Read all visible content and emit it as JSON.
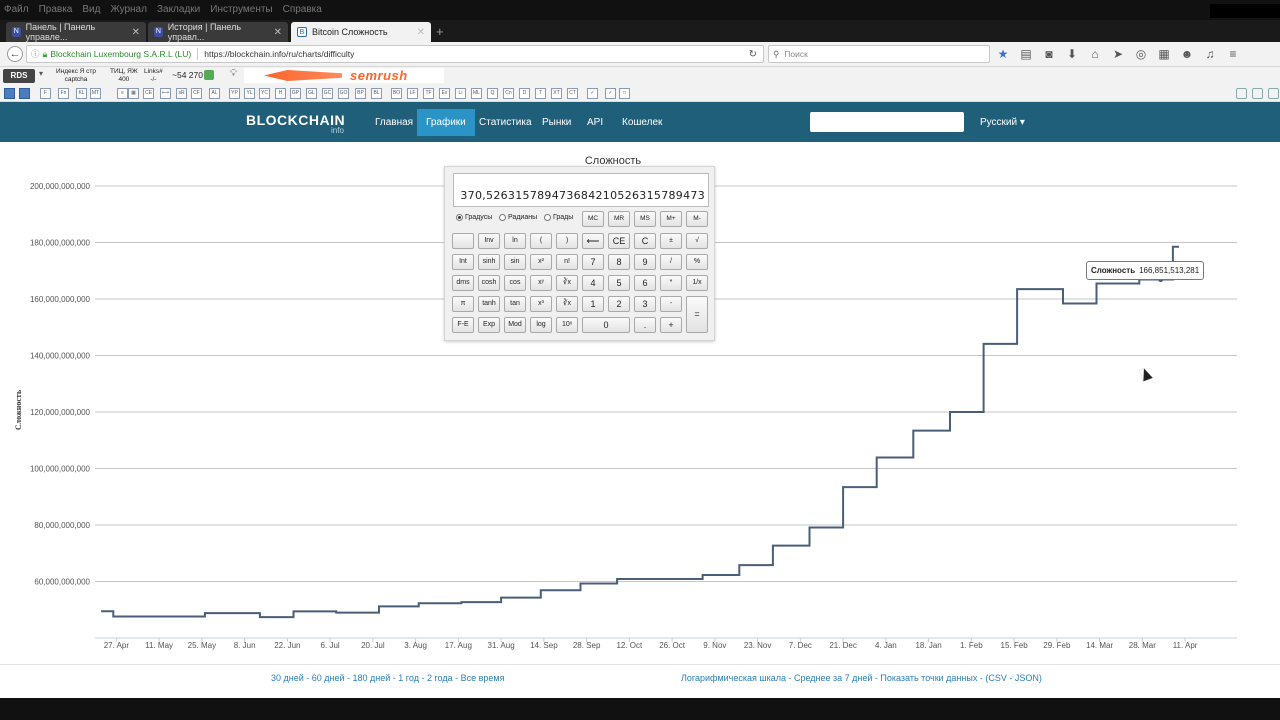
{
  "browser": {
    "menu": [
      "Файл",
      "Правка",
      "Вид",
      "Журнал",
      "Закладки",
      "Инструменты",
      "Справка"
    ],
    "tabs": [
      {
        "label": "Панель | Панель управле...",
        "icon": "N"
      },
      {
        "label": "История | Панель управл...",
        "icon": "N"
      },
      {
        "label": "Bitcoin Сложность",
        "icon": "B"
      }
    ],
    "url_org": "Blockchain Luxembourg S.A.R.L (LU)",
    "url": "https://blockchain.info/ru/charts/difficulty",
    "search_placeholder": "Поиск",
    "icons": [
      "bookmark-star-icon",
      "reading-list-icon",
      "pocket-icon",
      "download-icon",
      "home-icon",
      "send-icon",
      "addon-icon",
      "sidebar-icon",
      "chat-icon",
      "music-icon",
      "menu-icon"
    ]
  },
  "extensions": {
    "rds_label": "RDS",
    "stats": [
      {
        "top": "Индекс Я стр",
        "bottom": "captcha"
      },
      {
        "top": "ТИЦ, ЯЖ",
        "bottom": "400"
      },
      {
        "top": "Links#",
        "bottom": "-/-"
      }
    ],
    "links_count": "~54 270",
    "semrush_label": "semrush",
    "mini_icons": [
      "F",
      "Fn",
      "KL",
      "MT",
      "≡",
      "▦",
      "CE",
      "⟷",
      "sR",
      "CF",
      "AL",
      "YP",
      "YL",
      "YC",
      "H",
      "GP",
      "GL",
      "GC",
      "GO",
      "BP",
      "BL",
      "BO",
      "LF",
      "TF",
      "Ex",
      "Li",
      "ML",
      "Q",
      "Cn",
      "D",
      "T",
      "XT",
      "CT",
      "✓",
      "✓",
      "□"
    ]
  },
  "site": {
    "logo": "BLOCKCHAIN",
    "logo_sub": "info",
    "nav": [
      "Главная",
      "Графики",
      "Статистика",
      "Рынки",
      "API",
      "Кошелек"
    ],
    "active_nav": "Графики",
    "language": "Русский ▾"
  },
  "chart_data": {
    "type": "line",
    "title": "Сложность",
    "ylabel": "Сложность",
    "xlabel": "",
    "ylim": [
      40000000000,
      200000000000
    ],
    "yticks": [
      "60,000,000,000",
      "80,000,000,000",
      "100,000,000,000",
      "120,000,000,000",
      "140,000,000,000",
      "160,000,000,000",
      "180,000,000,000",
      "200,000,000,000"
    ],
    "ytick_values": [
      60000000000,
      80000000000,
      100000000000,
      120000000000,
      140000000000,
      160000000000,
      180000000000,
      200000000000
    ],
    "xticks": [
      "27. Apr",
      "11. May",
      "25. May",
      "8. Jun",
      "22. Jun",
      "6. Jul",
      "20. Jul",
      "3. Aug",
      "17. Aug",
      "31. Aug",
      "14. Sep",
      "28. Sep",
      "12. Oct",
      "26. Oct",
      "9. Nov",
      "23. Nov",
      "7. Dec",
      "21. Dec",
      "4. Jan",
      "18. Jan",
      "1. Feb",
      "15. Feb",
      "29. Feb",
      "14. Mar",
      "28. Mar",
      "11. Apr"
    ],
    "x_range_days": [
      -7,
      367
    ],
    "series": [
      {
        "color": "#4a5e78",
        "points": [
          [
            -5,
            49500000000
          ],
          [
            -1,
            49500000000
          ],
          [
            -1,
            47600000000
          ],
          [
            29,
            47600000000
          ],
          [
            29,
            48800000000
          ],
          [
            47,
            48800000000
          ],
          [
            47,
            47400000000
          ],
          [
            58,
            47400000000
          ],
          [
            58,
            49400000000
          ],
          [
            72,
            49400000000
          ],
          [
            72,
            49000000000
          ],
          [
            86,
            49000000000
          ],
          [
            86,
            51200000000
          ],
          [
            99,
            51200000000
          ],
          [
            99,
            52300000000
          ],
          [
            113,
            52300000000
          ],
          [
            113,
            52700000000
          ],
          [
            126,
            52700000000
          ],
          [
            126,
            54300000000
          ],
          [
            139,
            54300000000
          ],
          [
            139,
            56900000000
          ],
          [
            152,
            56900000000
          ],
          [
            152,
            59300000000
          ],
          [
            164,
            59300000000
          ],
          [
            164,
            60900000000
          ],
          [
            178,
            60900000000
          ],
          [
            178,
            60900000000
          ],
          [
            192,
            60900000000
          ],
          [
            192,
            62300000000
          ],
          [
            204,
            62300000000
          ],
          [
            204,
            65800000000
          ],
          [
            215,
            65800000000
          ],
          [
            215,
            72700000000
          ],
          [
            227,
            72700000000
          ],
          [
            227,
            79100000000
          ],
          [
            238,
            79100000000
          ],
          [
            238,
            93400000000
          ],
          [
            249,
            93400000000
          ],
          [
            249,
            103900000000
          ],
          [
            261,
            103900000000
          ],
          [
            261,
            113400000000
          ],
          [
            273,
            113400000000
          ],
          [
            273,
            120000000000
          ],
          [
            284,
            120000000000
          ],
          [
            284,
            144100000000
          ],
          [
            295,
            144100000000
          ],
          [
            295,
            163500000000
          ],
          [
            310,
            163500000000
          ],
          [
            310,
            158400000000
          ],
          [
            321,
            158400000000
          ],
          [
            321,
            165500000000
          ],
          [
            335,
            165500000000
          ],
          [
            335,
            166900000000
          ],
          [
            346,
            166900000000
          ],
          [
            346,
            178500000000
          ],
          [
            348,
            178500000000
          ]
        ]
      }
    ],
    "tooltip": {
      "label": "Сложность",
      "value": "166,851,513,281"
    }
  },
  "calculator": {
    "display": "370,526315789473684210526315789473",
    "modes": [
      "Градусы",
      "Радианы",
      "Грады"
    ],
    "selected_mode": "Градусы",
    "rows": [
      [
        "MC",
        "MR",
        "MS",
        "M+",
        "M-"
      ],
      [
        "",
        "Inv",
        "ln",
        "(",
        ")",
        "⟵",
        "CE",
        "C",
        "±",
        "√"
      ],
      [
        "Int",
        "sinh",
        "sin",
        "x²",
        "n!",
        "7",
        "8",
        "9",
        "/",
        "%"
      ],
      [
        "dms",
        "cosh",
        "cos",
        "xʸ",
        "∛x",
        "4",
        "5",
        "6",
        "*",
        "1/x"
      ],
      [
        "π",
        "tanh",
        "tan",
        "x³",
        "∛x",
        "1",
        "2",
        "3",
        "-",
        "="
      ],
      [
        "F-E",
        "Exp",
        "Mod",
        "log",
        "10ˣ",
        "0",
        ".",
        "+"
      ]
    ]
  },
  "footer": {
    "ranges": "30 дней - 60 дней - 180 дней - 1 год - 2 года - Все время",
    "options": "Логарифмическая шкала - Среднее за 7 дней - Показать точки данных - (CSV - JSON)"
  }
}
